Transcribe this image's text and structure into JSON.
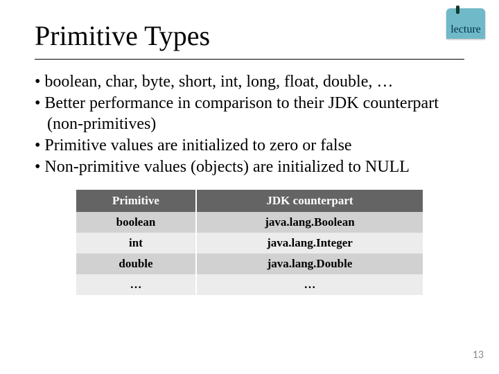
{
  "title": "Primitive Types",
  "badge": {
    "text": "lecture"
  },
  "bullets": [
    "boolean, char, byte, short, int, long, float, double, …",
    "Better performance in comparison to their JDK counterpart (non-primitives)",
    "Primitive values are initialized to zero or false",
    "Non-primitive values (objects) are initialized to NULL"
  ],
  "table": {
    "headers": [
      "Primitive",
      "JDK counterpart"
    ],
    "rows": [
      [
        "boolean",
        "java.lang.Boolean"
      ],
      [
        "int",
        "java.lang.Integer"
      ],
      [
        "double",
        "java.lang.Double"
      ],
      [
        "…",
        "…"
      ]
    ]
  },
  "pagenum": "13"
}
